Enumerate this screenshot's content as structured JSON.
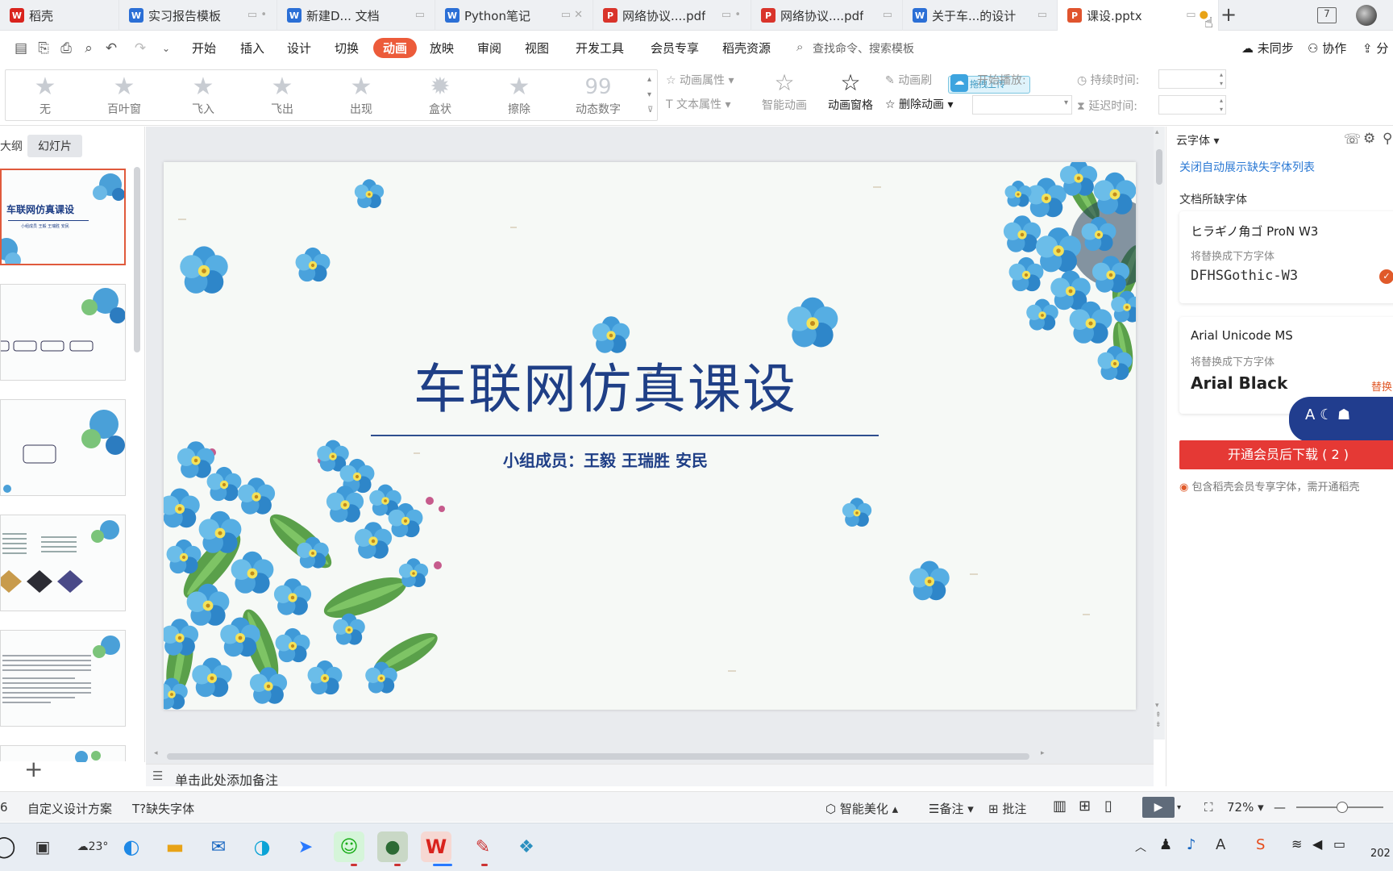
{
  "tabs": [
    {
      "label": "稻壳",
      "icon": "docer-icon",
      "color": "#d9231d"
    },
    {
      "label": "实习报告模板",
      "icon": "word-icon",
      "color": "#2b6fd6"
    },
    {
      "label": "新建D... 文档",
      "icon": "word-icon",
      "color": "#2b6fd6"
    },
    {
      "label": "Python笔记",
      "icon": "word-icon",
      "color": "#2b6fd6"
    },
    {
      "label": "网络协议....pdf",
      "icon": "pdf-icon",
      "color": "#d9342b"
    },
    {
      "label": "网络协议....pdf",
      "icon": "pdf-icon",
      "color": "#d9342b"
    },
    {
      "label": "关于车...的设计",
      "icon": "word-icon",
      "color": "#2b6fd6"
    },
    {
      "label": "课设.pptx",
      "icon": "ppt-icon",
      "color": "#e0542e"
    }
  ],
  "tabbar": {
    "new_tab": "+",
    "badge": "7"
  },
  "menu": {
    "items": [
      "开始",
      "插入",
      "设计",
      "切换",
      "动画",
      "放映",
      "审阅",
      "视图",
      "开发工具",
      "会员专享",
      "稻壳资源"
    ],
    "active": "动画",
    "search_placeholder": "查找命令、搜索模板",
    "sync": "未同步",
    "collab": "协作",
    "share": "分"
  },
  "ribbon": {
    "effects": [
      "无",
      "百叶窗",
      "飞入",
      "飞出",
      "出现",
      "盒状",
      "擦除",
      "动态数字"
    ],
    "anim_props": "动画属性",
    "text_props": "文本属性",
    "smart_anim": "智能动画",
    "anim_pane": "动画窗格",
    "anim_brush": "动画刷",
    "delete_anim": "删除动画",
    "start_play": "开始播放:",
    "duration": "持续时间:",
    "delay": "延迟时间:",
    "upload_badge": "拖拽上传"
  },
  "leftpane": {
    "tab_outline": "大纲",
    "tab_slides": "幻灯片",
    "add": "+"
  },
  "slide": {
    "title": "车联网仿真课设",
    "members": "小组成员：王毅  王瑞胜  安民"
  },
  "thumb1": {
    "title": "车联网仿真课设",
    "members": "小组成员 王毅 王瑞胜 安民"
  },
  "notes": {
    "placeholder": "单击此处添加备注"
  },
  "rightpane": {
    "title": "云字体",
    "close_link": "关闭自动展示缺失字体列表",
    "section": "文档所缺字体",
    "fonts": [
      {
        "missing": "ヒラギノ角ゴ ProN W3",
        "hint": "将替换成下方字体",
        "replacement": "DFHSGothic-W3"
      },
      {
        "missing": "Arial Unicode MS",
        "hint": "将替换成下方字体",
        "replacement": "Arial Black",
        "action": "替换"
      }
    ],
    "download_button": "开通会员后下载 ( 2 )",
    "member_note": "包含稻壳会员专享字体，需开通稻壳"
  },
  "statusbar": {
    "slide_num": "6",
    "design": "自定义设计方案",
    "missing_fonts": "缺失字体",
    "beautify": "智能美化",
    "notes": "备注",
    "comments": "批注",
    "zoom": "72%"
  },
  "taskbar": {
    "temperature": "23°",
    "year": "202"
  }
}
